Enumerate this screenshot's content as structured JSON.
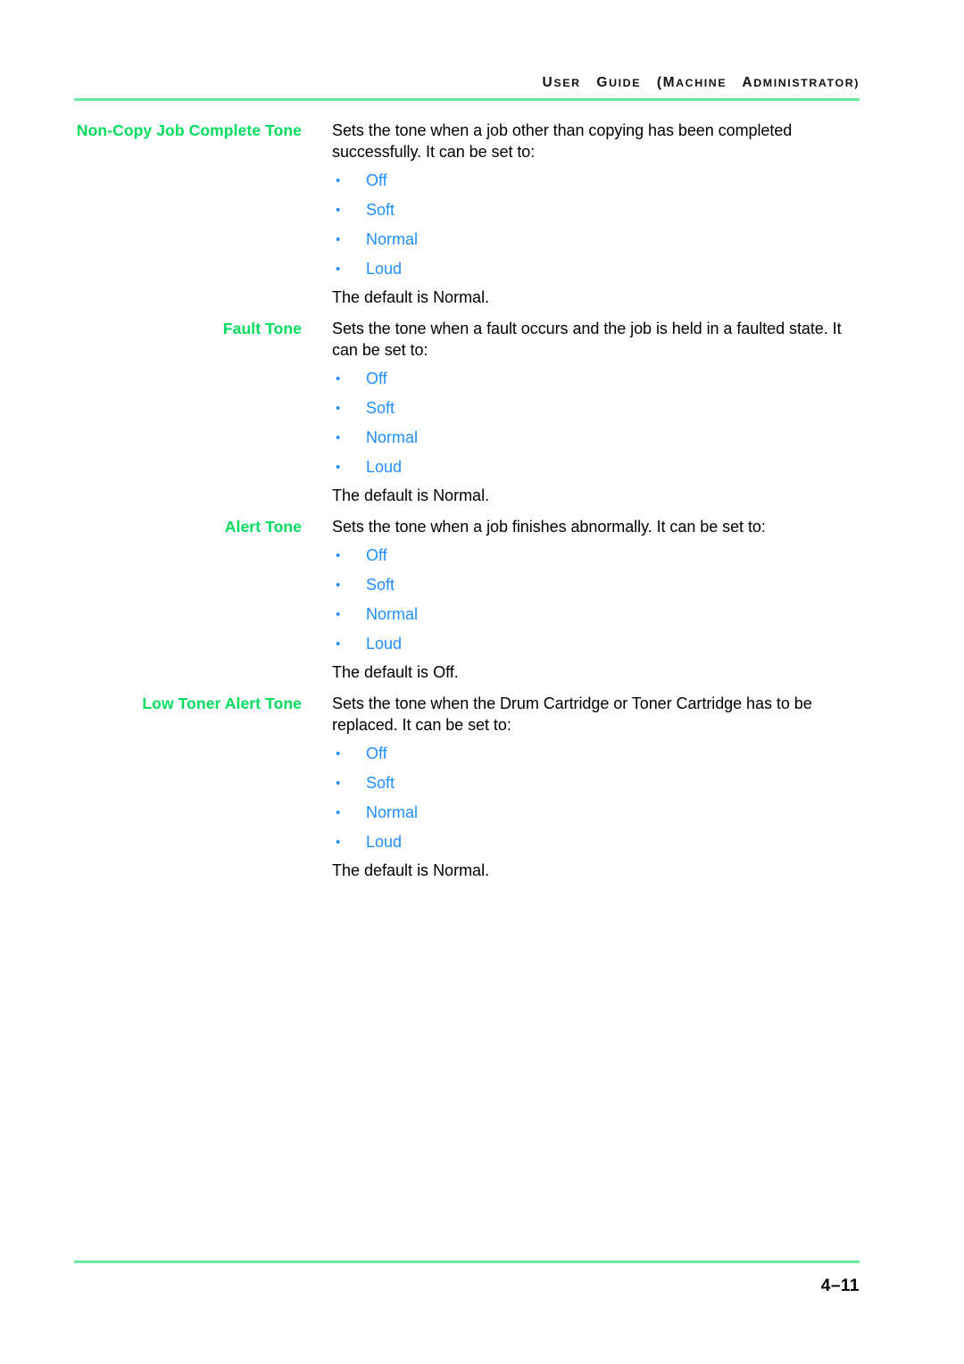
{
  "header": {
    "title_initial": "U",
    "title": "USER GUIDE (MACHINE ADMINISTRATOR)",
    "parts": [
      {
        "cap": "U",
        "rest": "SER"
      },
      {
        "cap": "G",
        "rest": "UIDE"
      },
      {
        "cap": "(M",
        "rest": "ACHINE"
      },
      {
        "cap": "A",
        "rest": "DMINISTRATOR)"
      }
    ]
  },
  "footer": {
    "page_number": "4–11"
  },
  "colors": {
    "term_green": "#00dd5c",
    "option_blue": "#1f8fff",
    "rule_green": "#66ea9b",
    "body_black": "#000000"
  },
  "entries": [
    {
      "term": "Non-Copy Job Complete Tone",
      "description": "Sets the tone when a job other than copying has been completed successfully.  It can be set to:",
      "options": [
        "Off",
        "Soft",
        "Normal",
        "Loud"
      ],
      "default_text": "The default is Normal."
    },
    {
      "term": "Fault Tone",
      "description": "Sets the tone when a fault occurs and the job is held in a faulted state.  It can be set to:",
      "options": [
        "Off",
        "Soft",
        "Normal",
        "Loud"
      ],
      "default_text": "The default is Normal."
    },
    {
      "term": "Alert Tone",
      "description": "Sets the tone when a job finishes abnormally.  It can be set to:",
      "options": [
        "Off",
        "Soft",
        "Normal",
        "Loud"
      ],
      "default_text": "The default is Off."
    },
    {
      "term": "Low Toner Alert Tone",
      "description": "Sets the tone when the Drum Cartridge or Toner Cartridge has to be replaced.  It can be set to:",
      "options": [
        "Off",
        "Soft",
        "Normal",
        "Loud"
      ],
      "default_text": "The default is Normal."
    }
  ]
}
